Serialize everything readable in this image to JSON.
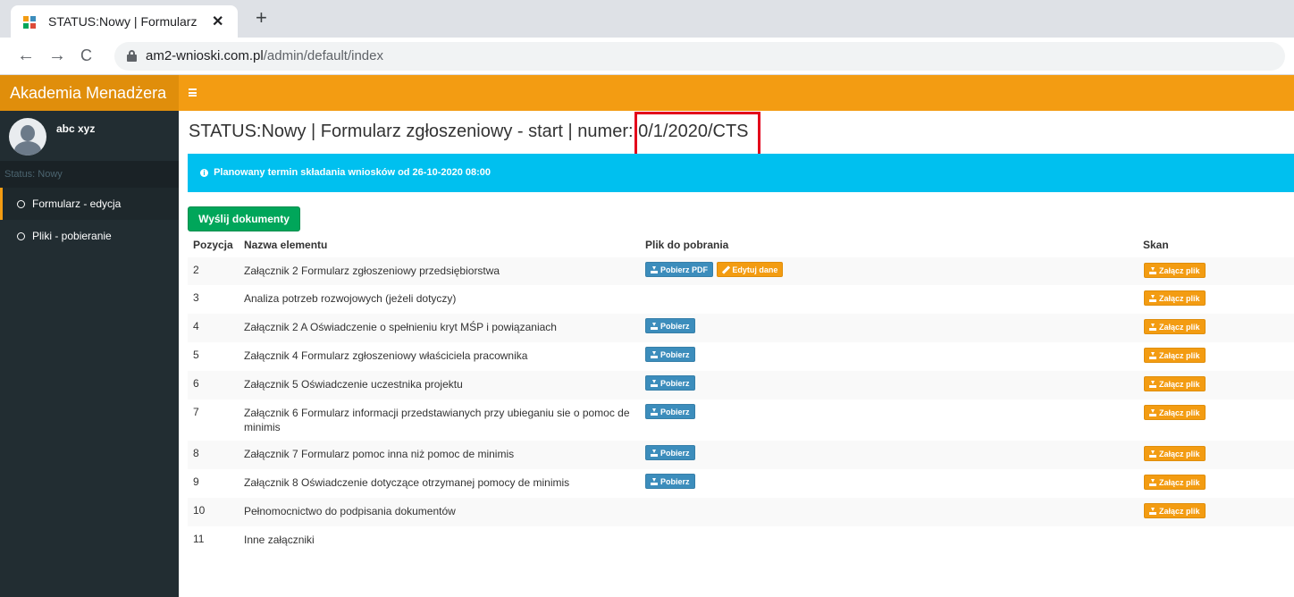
{
  "browser": {
    "tab_title": "STATUS:Nowy | Formularz zgłoszeniowy",
    "close_glyph": "✕",
    "new_tab_glyph": "+",
    "url_host": "am2-wnioski.com.pl",
    "url_path": "/admin/default/index",
    "back_glyph": "←",
    "forward_glyph": "→",
    "reload_glyph": "C"
  },
  "header": {
    "brand": "Akademia Menadżera",
    "menu_icon": "hamburger-icon"
  },
  "sidebar": {
    "user_name": "abc xyz",
    "status_label": "Status: Nowy",
    "items": [
      {
        "label": "Formularz - edycja",
        "active": true
      },
      {
        "label": "Pliki - pobieranie",
        "active": false
      }
    ]
  },
  "main": {
    "title": "STATUS:Nowy | Formularz zgłoszeniowy - start | numer: 0/1/2020/CTS",
    "alert": "Planowany termin składania wniosków od 26-10-2020 08:00",
    "send_button": "Wyślij dokumenty",
    "columns": [
      "Pozycja",
      "Nazwa elementu",
      "Plik do pobrania",
      "Skan"
    ],
    "buttons": {
      "pdf": "Pobierz PDF",
      "edit": "Edytuj dane",
      "download": "Pobierz",
      "attach": "Załącz plik"
    },
    "rows": [
      {
        "pos": "2",
        "name": "Załącznik 2 Formularz zgłoszeniowy przedsiębiorstwa",
        "download": "pdf+edit",
        "attach": true
      },
      {
        "pos": "3",
        "name": "Analiza potrzeb rozwojowych (jeżeli dotyczy)",
        "download": "none",
        "attach": true
      },
      {
        "pos": "4",
        "name": "Załącznik 2 A Oświadczenie o spełnieniu kryt MŚP i powiązaniach",
        "download": "download",
        "attach": true
      },
      {
        "pos": "5",
        "name": "Załącznik 4 Formularz zgłoszeniowy właściciela pracownika",
        "download": "download",
        "attach": true
      },
      {
        "pos": "6",
        "name": "Załącznik 5 Oświadczenie uczestnika projektu",
        "download": "download",
        "attach": true
      },
      {
        "pos": "7",
        "name": "Załącznik 6 Formularz informacji przedstawianych przy ubieganiu sie o pomoc de minimis",
        "download": "download",
        "attach": true
      },
      {
        "pos": "8",
        "name": "Załącznik 7 Formularz pomoc inna niż pomoc de minimis",
        "download": "download",
        "attach": true
      },
      {
        "pos": "9",
        "name": "Załącznik 8 Oświadczenie dotyczące otrzymanej pomocy de minimis",
        "download": "download",
        "attach": true
      },
      {
        "pos": "10",
        "name": "Pełnomocnictwo do podpisania dokumentów",
        "download": "none",
        "attach": true
      },
      {
        "pos": "11",
        "name": "Inne załączniki",
        "download": "none",
        "attach": false
      }
    ]
  },
  "colors": {
    "accent": "#f39c12",
    "sidebar": "#222d32",
    "info": "#00c0ef",
    "success": "#00a65a",
    "primary": "#3c8dbc",
    "highlight": "#e3001b"
  }
}
